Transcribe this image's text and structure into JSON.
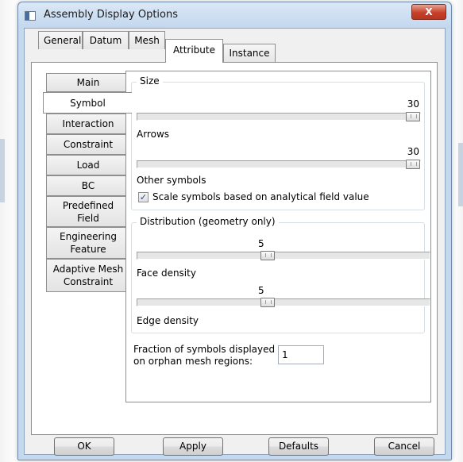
{
  "window": {
    "title": "Assembly Display Options",
    "close_glyph": "X"
  },
  "tabs": [
    {
      "label": "General"
    },
    {
      "label": "Datum"
    },
    {
      "label": "Mesh"
    },
    {
      "label": "Attribute"
    },
    {
      "label": "Instance"
    }
  ],
  "active_tab": "Attribute",
  "sidebar": {
    "items": [
      {
        "label": "Main"
      },
      {
        "label": "Symbol"
      },
      {
        "label": "Interaction"
      },
      {
        "label": "Constraint"
      },
      {
        "label": "Load"
      },
      {
        "label": "BC"
      },
      {
        "label": "Predefined Field"
      },
      {
        "label": "Engineering Feature"
      },
      {
        "label": "Adaptive Mesh Constraint"
      }
    ],
    "active": "Symbol"
  },
  "size_group": {
    "legend": "Size",
    "arrows": {
      "value": "30",
      "label": "Arrows",
      "fraction": 1.0
    },
    "other": {
      "value": "30",
      "label": "Other symbols",
      "fraction": 1.0
    },
    "scale_checkbox": {
      "label": "Scale symbols based on analytical field value",
      "checked": true,
      "glyph": "✓"
    }
  },
  "distribution_group": {
    "legend": "Distribution (geometry only)",
    "face": {
      "value": "5",
      "label": "Face density",
      "fraction": 0.44
    },
    "edge": {
      "value": "5",
      "label": "Edge density",
      "fraction": 0.44
    }
  },
  "fraction": {
    "label_line1": "Fraction of symbols displayed",
    "label_line2": "on orphan mesh regions:",
    "value": "1"
  },
  "buttons": {
    "ok": "OK",
    "apply": "Apply",
    "defaults": "Defaults",
    "cancel": "Cancel"
  }
}
